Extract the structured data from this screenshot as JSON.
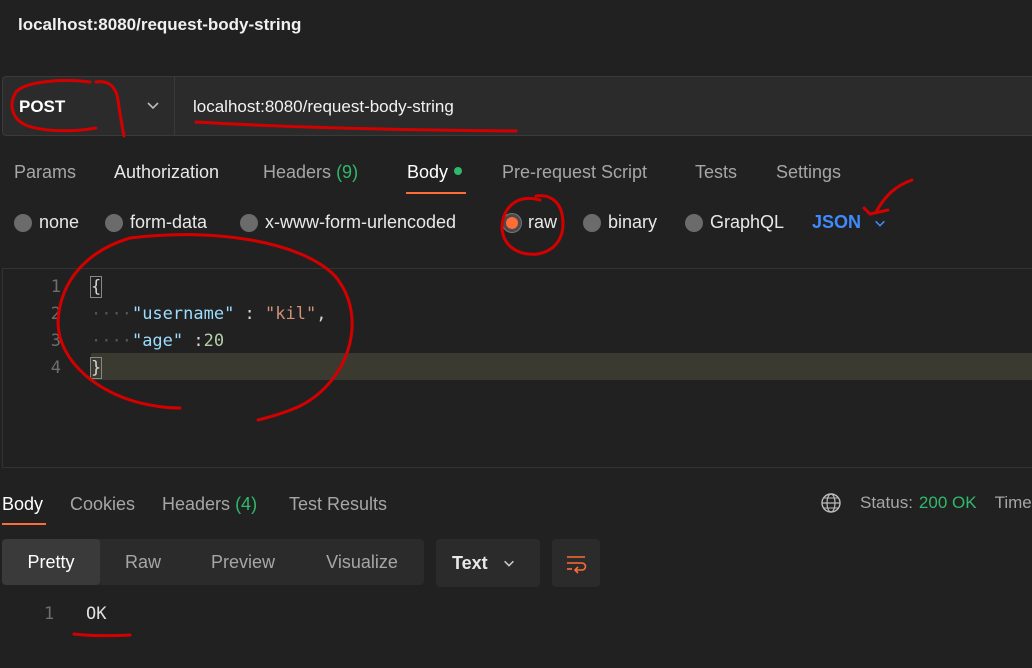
{
  "window": {
    "title": "localhost:8080/request-body-string"
  },
  "request": {
    "method": "POST",
    "url": "localhost:8080/request-body-string"
  },
  "tabs": [
    {
      "label": "Params"
    },
    {
      "label": "Authorization"
    },
    {
      "label": "Headers",
      "count": "(9)"
    },
    {
      "label": "Body",
      "active": true
    },
    {
      "label": "Pre-request Script"
    },
    {
      "label": "Tests"
    },
    {
      "label": "Settings"
    }
  ],
  "body_types": [
    {
      "label": "none",
      "selected": false
    },
    {
      "label": "form-data",
      "selected": false
    },
    {
      "label": "x-www-form-urlencoded",
      "selected": false
    },
    {
      "label": "raw",
      "selected": true
    },
    {
      "label": "binary",
      "selected": false
    },
    {
      "label": "GraphQL",
      "selected": false
    }
  ],
  "raw_format": "JSON",
  "editor": {
    "lines": [
      {
        "num": "1",
        "text": "{"
      },
      {
        "num": "2",
        "key": "\"username\"",
        "sep": " : ",
        "value": "\"kil\"",
        "tail": ","
      },
      {
        "num": "3",
        "key": "\"age\"",
        "sep": " :",
        "value": "20"
      },
      {
        "num": "4",
        "text": "}"
      }
    ]
  },
  "response": {
    "tabs": [
      {
        "label": "Body",
        "active": true
      },
      {
        "label": "Cookies"
      },
      {
        "label": "Headers",
        "count": "(4)"
      },
      {
        "label": "Test Results"
      }
    ],
    "status_label": "Status:",
    "status_value": "200 OK",
    "time_label": "Time",
    "view_modes": [
      "Pretty",
      "Raw",
      "Preview",
      "Visualize"
    ],
    "format": "Text",
    "output": [
      {
        "num": "1",
        "text": "OK"
      }
    ]
  },
  "colors": {
    "accent": "#ff6c37",
    "success": "#2fba6b",
    "link": "#3f8bfd",
    "annotation": "#d40000"
  },
  "icons": [
    "chevron-down-icon",
    "globe-icon",
    "wrap-lines-icon"
  ]
}
